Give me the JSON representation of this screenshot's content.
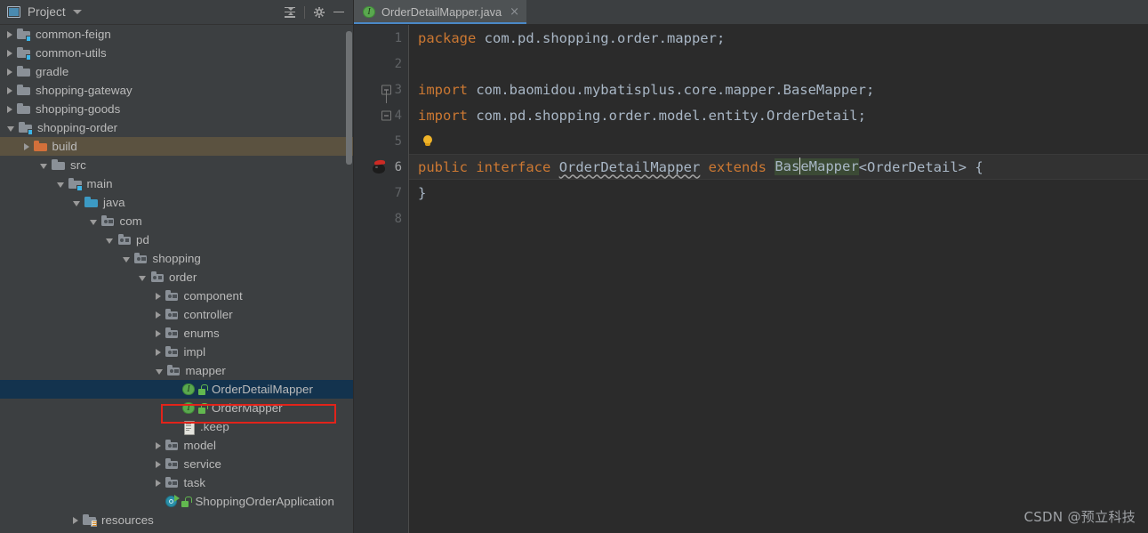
{
  "sidebar": {
    "title": "Project",
    "toolbar": {
      "collapse_all": "Collapse All",
      "settings": "Settings",
      "hide": "Hide"
    },
    "tree": [
      {
        "label": "common-feign",
        "depth": 0,
        "icon": "module-folder-icon",
        "arrow": "closed",
        "state": "normal"
      },
      {
        "label": "common-utils",
        "depth": 0,
        "icon": "module-folder-icon",
        "arrow": "closed",
        "state": "normal"
      },
      {
        "label": "gradle",
        "depth": 0,
        "icon": "folder-icon",
        "arrow": "closed",
        "state": "normal"
      },
      {
        "label": "shopping-gateway",
        "depth": 0,
        "icon": "folder-icon",
        "arrow": "closed",
        "state": "normal"
      },
      {
        "label": "shopping-goods",
        "depth": 0,
        "icon": "folder-icon",
        "arrow": "closed",
        "state": "normal"
      },
      {
        "label": "shopping-order",
        "depth": 0,
        "icon": "module-folder-icon",
        "arrow": "open",
        "state": "normal"
      },
      {
        "label": "build",
        "depth": 1,
        "icon": "excluded-folder-icon",
        "arrow": "closed",
        "state": "hovered"
      },
      {
        "label": "src",
        "depth": 2,
        "icon": "folder-icon",
        "arrow": "open",
        "state": "normal"
      },
      {
        "label": "main",
        "depth": 3,
        "icon": "module-folder-icon",
        "arrow": "open",
        "state": "normal"
      },
      {
        "label": "java",
        "depth": 4,
        "icon": "source-folder-icon",
        "arrow": "open",
        "state": "normal"
      },
      {
        "label": "com",
        "depth": 5,
        "icon": "package-icon",
        "arrow": "open",
        "state": "normal"
      },
      {
        "label": "pd",
        "depth": 6,
        "icon": "package-icon",
        "arrow": "open",
        "state": "normal"
      },
      {
        "label": "shopping",
        "depth": 7,
        "icon": "package-icon",
        "arrow": "open",
        "state": "normal"
      },
      {
        "label": "order",
        "depth": 8,
        "icon": "package-icon",
        "arrow": "open",
        "state": "normal"
      },
      {
        "label": "component",
        "depth": 9,
        "icon": "package-icon",
        "arrow": "closed",
        "state": "normal"
      },
      {
        "label": "controller",
        "depth": 9,
        "icon": "package-icon",
        "arrow": "closed",
        "state": "normal"
      },
      {
        "label": "enums",
        "depth": 9,
        "icon": "package-icon",
        "arrow": "closed",
        "state": "normal"
      },
      {
        "label": "impl",
        "depth": 9,
        "icon": "package-icon",
        "arrow": "closed",
        "state": "normal"
      },
      {
        "label": "mapper",
        "depth": 9,
        "icon": "package-icon",
        "arrow": "open",
        "state": "normal"
      },
      {
        "label": "OrderDetailMapper",
        "depth": 10,
        "icon": "interface-icon",
        "arrow": "none",
        "state": "selected"
      },
      {
        "label": "OrderMapper",
        "depth": 10,
        "icon": "interface-icon",
        "arrow": "none",
        "state": "normal"
      },
      {
        "label": ".keep",
        "depth": 10,
        "icon": "file-icon",
        "arrow": "none",
        "state": "normal"
      },
      {
        "label": "model",
        "depth": 9,
        "icon": "package-icon",
        "arrow": "closed",
        "state": "normal"
      },
      {
        "label": "service",
        "depth": 9,
        "icon": "package-icon",
        "arrow": "closed",
        "state": "normal"
      },
      {
        "label": "task",
        "depth": 9,
        "icon": "package-icon",
        "arrow": "closed",
        "state": "normal"
      },
      {
        "label": "ShoppingOrderApplication",
        "depth": 9,
        "icon": "springboot-class-icon",
        "arrow": "none",
        "state": "normal"
      },
      {
        "label": "resources",
        "depth": 4,
        "icon": "resources-folder-icon",
        "arrow": "closed",
        "state": "normal"
      }
    ]
  },
  "editor": {
    "tab": {
      "title": "OrderDetailMapper.java",
      "icon": "interface-icon",
      "close_label": "×",
      "active": true
    },
    "lines": [
      {
        "num": "1",
        "gutter": "none",
        "current": false
      },
      {
        "num": "2",
        "gutter": "none",
        "current": false
      },
      {
        "num": "3",
        "gutter": "fold-open",
        "current": false
      },
      {
        "num": "4",
        "gutter": "fold-plain",
        "current": false
      },
      {
        "num": "5",
        "gutter": "none",
        "current": false
      },
      {
        "num": "6",
        "gutter": "mapper-icon",
        "current": true
      },
      {
        "num": "7",
        "gutter": "none",
        "current": false
      },
      {
        "num": "8",
        "gutter": "none",
        "current": false
      }
    ],
    "code": {
      "l1_kw": "package",
      "l1_rest": " com.pd.shopping.order.mapper;",
      "l3_kw": "import",
      "l3_pkg": " com.baomidou.mybatisplus.core.mapper.",
      "l3_cls": "BaseMapper",
      "l3_end": ";",
      "l4_kw": "import",
      "l4_pkg": " com.pd.shopping.order.model.entity.",
      "l4_cls": "OrderDetail",
      "l4_end": ";",
      "l6_kw1": "public",
      "l6_kw2": "interface",
      "l6_name": "OrderDetailMapper",
      "l6_kw3": "extends",
      "l6_base_a": "Bas",
      "l6_base_b": "eMapper",
      "l6_generic": "<OrderDetail> {",
      "l7_brace": "}"
    }
  },
  "watermark": "CSDN @预立科技",
  "colors": {
    "accent": "#4a88c7",
    "keyword": "#cc7832",
    "selection": "#13334e",
    "hover": "#5b5240",
    "annotation": "#e2231a",
    "interface_green": "#5aa84f",
    "excluded_orange": "#d2703a",
    "source_blue": "#3c9ac4"
  }
}
